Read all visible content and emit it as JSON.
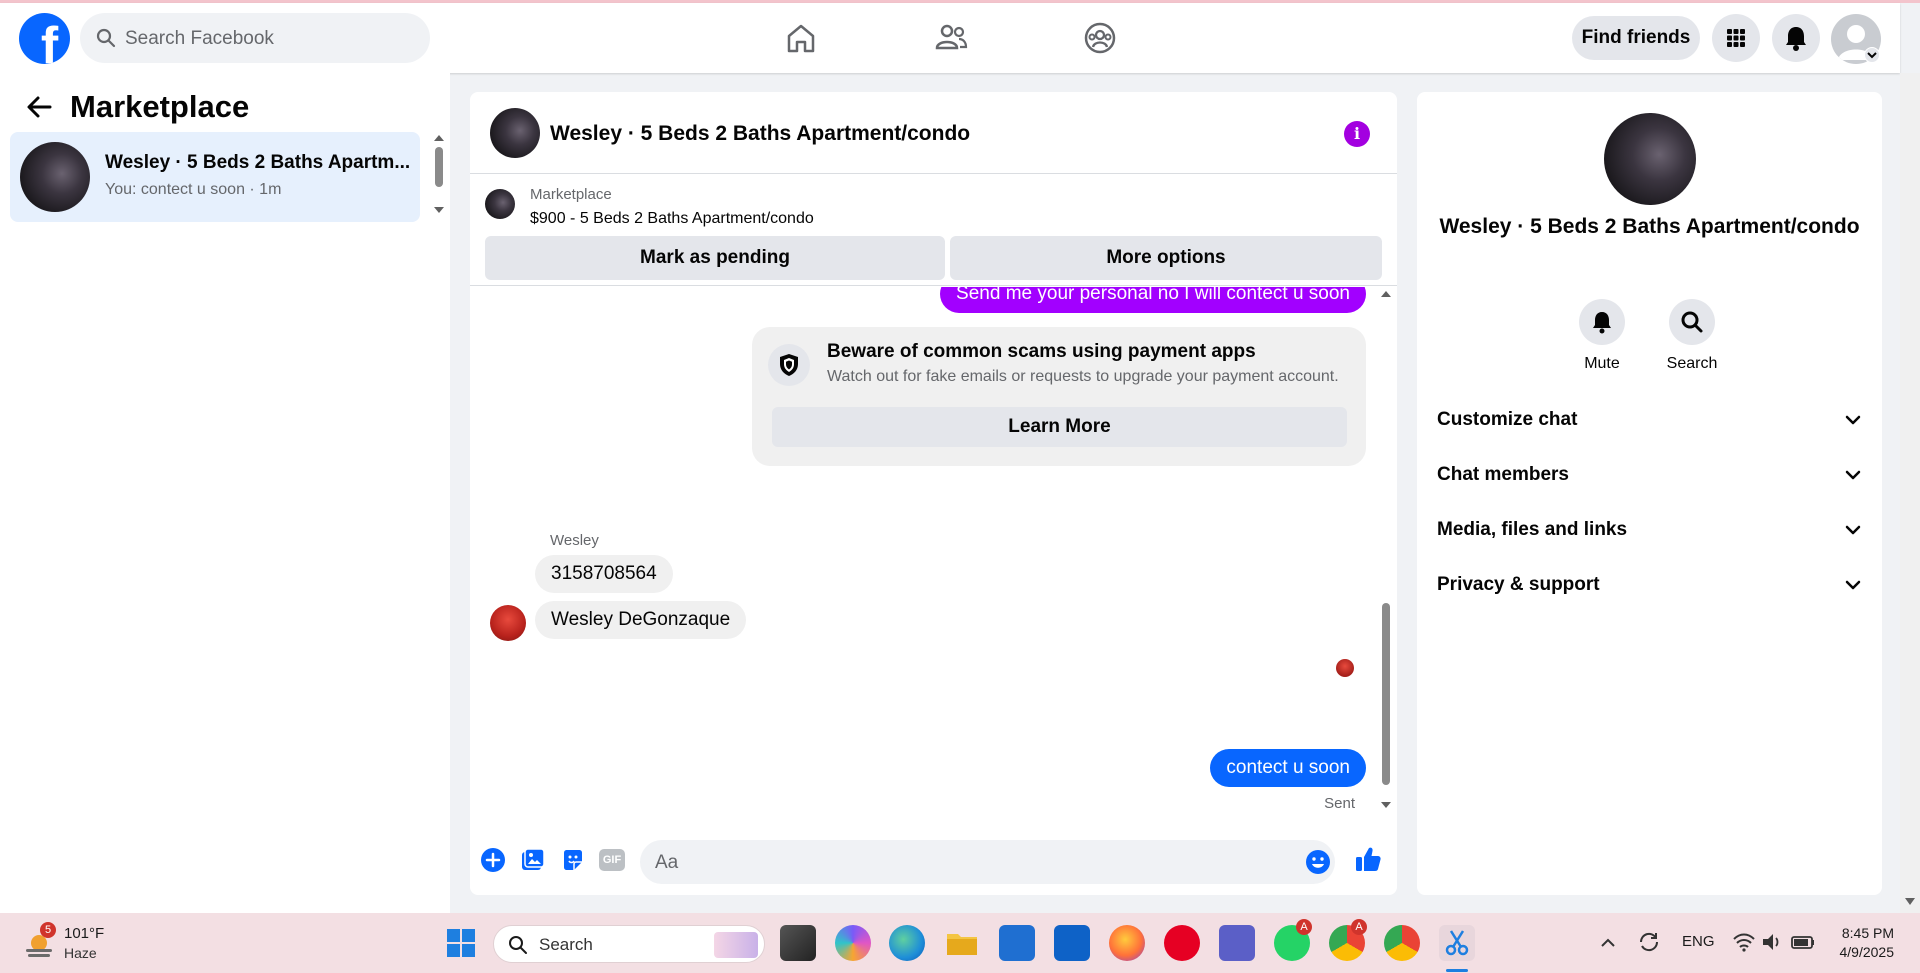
{
  "topbar": {
    "search_placeholder": "Search Facebook",
    "find_friends": "Find friends"
  },
  "left": {
    "title": "Marketplace",
    "conversation": {
      "title": "Wesley · 5 Beds 2 Baths Apartm...",
      "preview": "You: contect u soon · 1m"
    }
  },
  "chat": {
    "header_title": "Wesley · 5 Beds 2 Baths Apartment/condo",
    "listing": {
      "source": "Marketplace",
      "title": "$900 - 5 Beds 2 Baths Apartment/condo"
    },
    "mark_pending": "Mark as pending",
    "more_options": "More options",
    "messages": {
      "outgoing_top": "Send me your personal no I will contect u soon",
      "warning_title": "Beware of common scams using payment apps",
      "warning_body": "Watch out for fake emails or requests to upgrade your payment account.",
      "learn_more": "Learn More",
      "sender": "Wesley",
      "in1": "3158708564",
      "in2": "Wesley DeGonzaque",
      "outgoing_last": "contect u soon",
      "status": "Sent"
    },
    "composer_placeholder": "Aa",
    "gif_label": "GIF"
  },
  "right": {
    "name": "Wesley · 5 Beds 2 Baths Apartment/condo",
    "mute": "Mute",
    "search": "Search",
    "sections": [
      "Customize chat",
      "Chat members",
      "Media, files and links",
      "Privacy & support"
    ]
  },
  "taskbar": {
    "weather_badge": "5",
    "temperature": "101°F",
    "condition": "Haze",
    "search": "Search",
    "lang": "ENG",
    "time": "8:45 PM",
    "date": "4/9/2025",
    "badge_a": "A"
  },
  "colors": {
    "brand": "#0866ff",
    "outgoing_purple": "#a200ff",
    "info_purple": "#a300e0",
    "selected_row": "#e6f0fd"
  }
}
